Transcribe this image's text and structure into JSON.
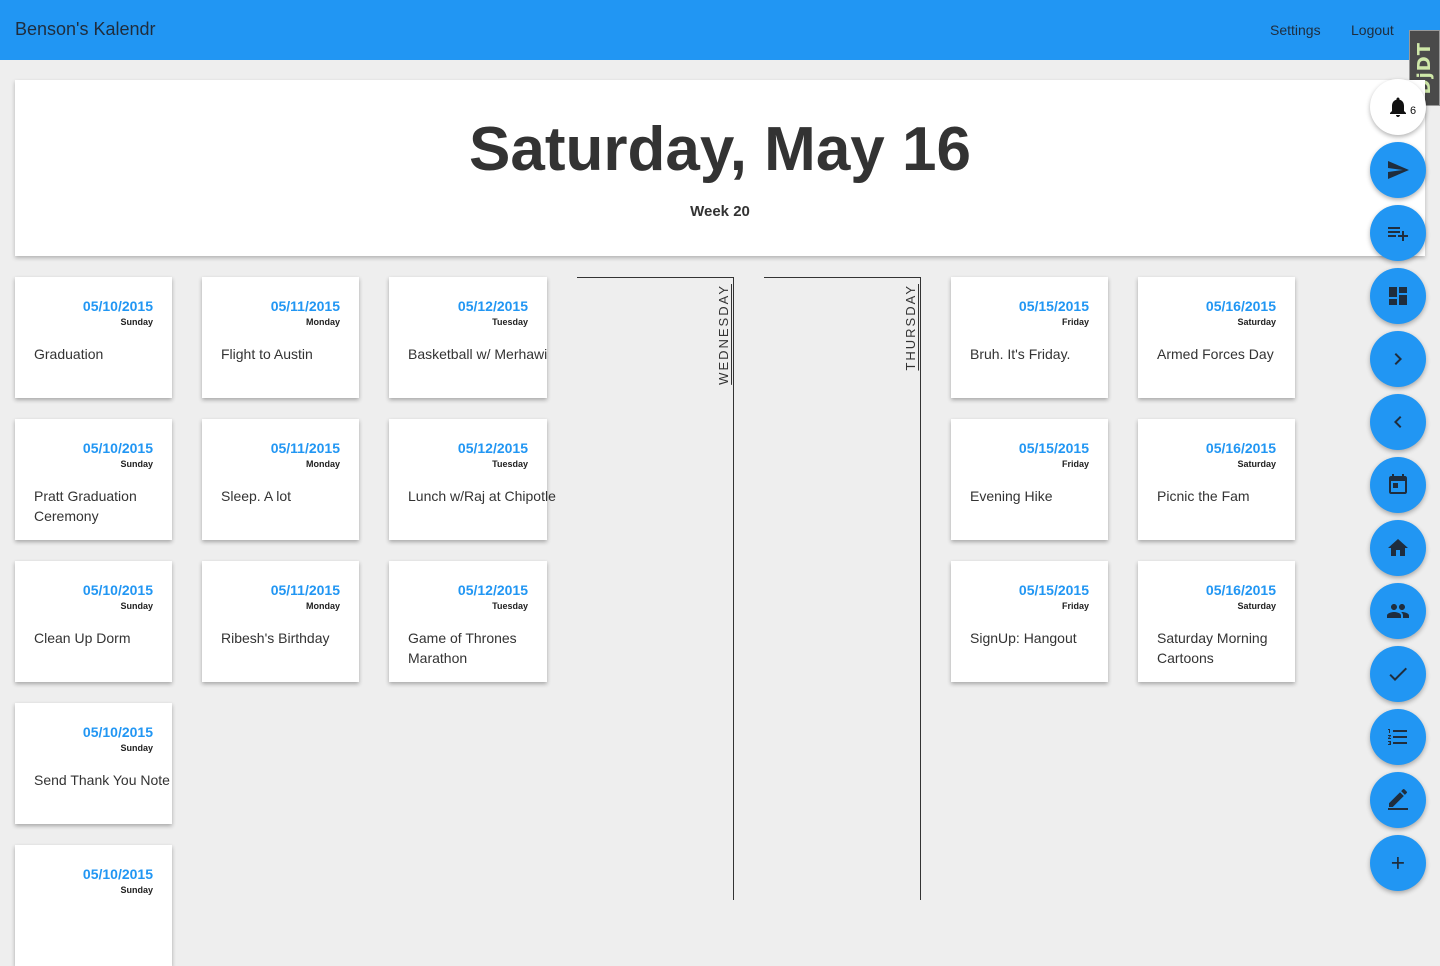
{
  "app": {
    "title": "Benson's Kalendr",
    "nav": {
      "settings": "Settings",
      "logout": "Logout"
    },
    "debug_badge": "DjDT"
  },
  "header": {
    "date": "Saturday, May 16",
    "week": "Week 20"
  },
  "days": [
    {
      "events": [
        {
          "date": "05/10/2015",
          "day": "Sunday",
          "title": "Graduation"
        },
        {
          "date": "05/10/2015",
          "day": "Sunday",
          "title": "Pratt Graduation Ceremony"
        },
        {
          "date": "05/10/2015",
          "day": "Sunday",
          "title": "Clean Up Dorm"
        },
        {
          "date": "05/10/2015",
          "day": "Sunday",
          "title": "Send Thank You Note"
        },
        {
          "date": "05/10/2015",
          "day": "Sunday",
          "title": ""
        }
      ]
    },
    {
      "events": [
        {
          "date": "05/11/2015",
          "day": "Monday",
          "title": "Flight to Austin"
        },
        {
          "date": "05/11/2015",
          "day": "Monday",
          "title": "Sleep. A lot"
        },
        {
          "date": "05/11/2015",
          "day": "Monday",
          "title": "Ribesh's Birthday"
        }
      ]
    },
    {
      "events": [
        {
          "date": "05/12/2015",
          "day": "Tuesday",
          "title": "Basketball w/ Merhawi"
        },
        {
          "date": "05/12/2015",
          "day": "Tuesday",
          "title": "Lunch w/Raj at Chipotle"
        },
        {
          "date": "05/12/2015",
          "day": "Tuesday",
          "title": "Game of Thrones Marathon"
        }
      ]
    },
    {
      "empty_label": "WEDNESDAY"
    },
    {
      "empty_label": "THURSDAY"
    },
    {
      "events": [
        {
          "date": "05/15/2015",
          "day": "Friday",
          "title": "Bruh. It's Friday."
        },
        {
          "date": "05/15/2015",
          "day": "Friday",
          "title": "Evening Hike"
        },
        {
          "date": "05/15/2015",
          "day": "Friday",
          "title": "SignUp: Hangout"
        }
      ]
    },
    {
      "events": [
        {
          "date": "05/16/2015",
          "day": "Saturday",
          "title": "Armed Forces Day"
        },
        {
          "date": "05/16/2015",
          "day": "Saturday",
          "title": "Picnic the Fam"
        },
        {
          "date": "05/16/2015",
          "day": "Saturday",
          "title": "Saturday Morning Cartoons"
        }
      ]
    }
  ],
  "fabs": {
    "notifications_count": "6",
    "icons": [
      "bell-icon",
      "send-icon",
      "playlist-add-icon",
      "dashboard-icon",
      "chevron-right-icon",
      "chevron-left-icon",
      "calendar-icon",
      "home-icon",
      "people-icon",
      "check-icon",
      "list-icon",
      "edit-icon",
      "add-icon"
    ]
  },
  "colors": {
    "primary": "#2196f3",
    "background": "#eeeeee",
    "text": "#333333"
  }
}
